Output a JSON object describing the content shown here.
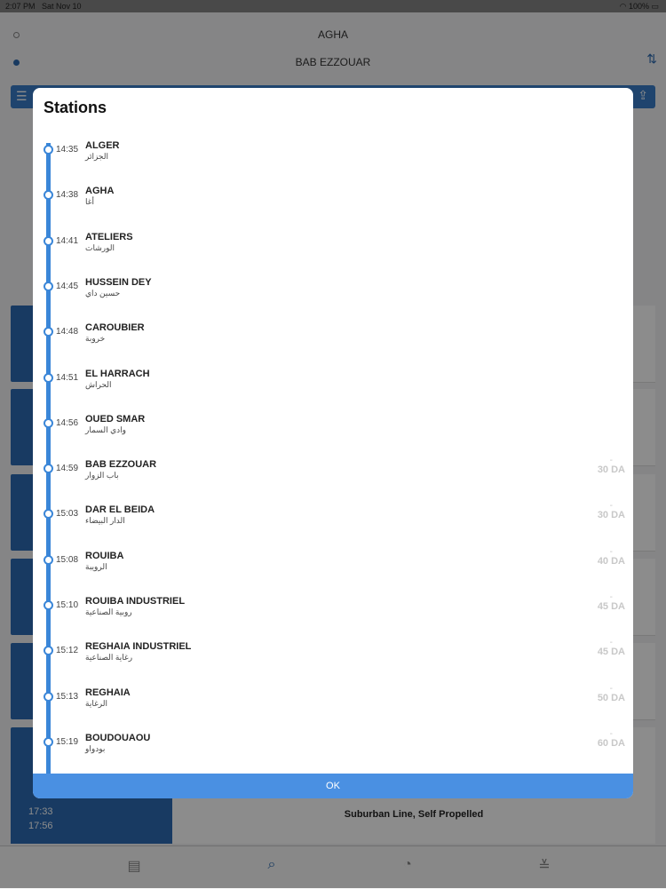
{
  "status_bar": {
    "time": "2:07 PM",
    "date": "Sat Nov 10",
    "battery": "100%"
  },
  "route": {
    "from": "AGHA",
    "to": "BAB EZZOUAR"
  },
  "background": {
    "bottom_card": {
      "times": [
        "17:33",
        "17:56"
      ],
      "description": "Suburban Line, Self Propelled"
    }
  },
  "modal": {
    "title": "Stations",
    "ok_label": "OK",
    "stations": [
      {
        "time": "14:35",
        "name": "ALGER",
        "arabic": "الجزائر",
        "fare": ""
      },
      {
        "time": "14:38",
        "name": "AGHA",
        "arabic": "أغا",
        "fare": ""
      },
      {
        "time": "14:41",
        "name": "ATELIERS",
        "arabic": "الورشات",
        "fare": ""
      },
      {
        "time": "14:45",
        "name": "HUSSEIN DEY",
        "arabic": "حسين داي",
        "fare": ""
      },
      {
        "time": "14:48",
        "name": "CAROUBIER",
        "arabic": "خروبة",
        "fare": ""
      },
      {
        "time": "14:51",
        "name": "EL HARRACH",
        "arabic": "الحراش",
        "fare": ""
      },
      {
        "time": "14:56",
        "name": "OUED SMAR",
        "arabic": "وادي السمار",
        "fare": ""
      },
      {
        "time": "14:59",
        "name": "BAB EZZOUAR",
        "arabic": "باب الزوار",
        "fare": "30 DA"
      },
      {
        "time": "15:03",
        "name": "DAR EL BEIDA",
        "arabic": "الدار البيضاء",
        "fare": "30 DA"
      },
      {
        "time": "15:08",
        "name": "ROUIBA",
        "arabic": "الرويبة",
        "fare": "40 DA"
      },
      {
        "time": "15:10",
        "name": "ROUIBA INDUSTRIEL",
        "arabic": "روبية الصناعية",
        "fare": "45 DA"
      },
      {
        "time": "15:12",
        "name": "REGHAIA INDUSTRIEL",
        "arabic": "رغاية الصناعية",
        "fare": "45 DA"
      },
      {
        "time": "15:13",
        "name": "REGHAIA",
        "arabic": "الرغاية",
        "fare": "50 DA"
      },
      {
        "time": "15:19",
        "name": "BOUDOUAOU",
        "arabic": "بودواو",
        "fare": "60 DA"
      }
    ]
  }
}
